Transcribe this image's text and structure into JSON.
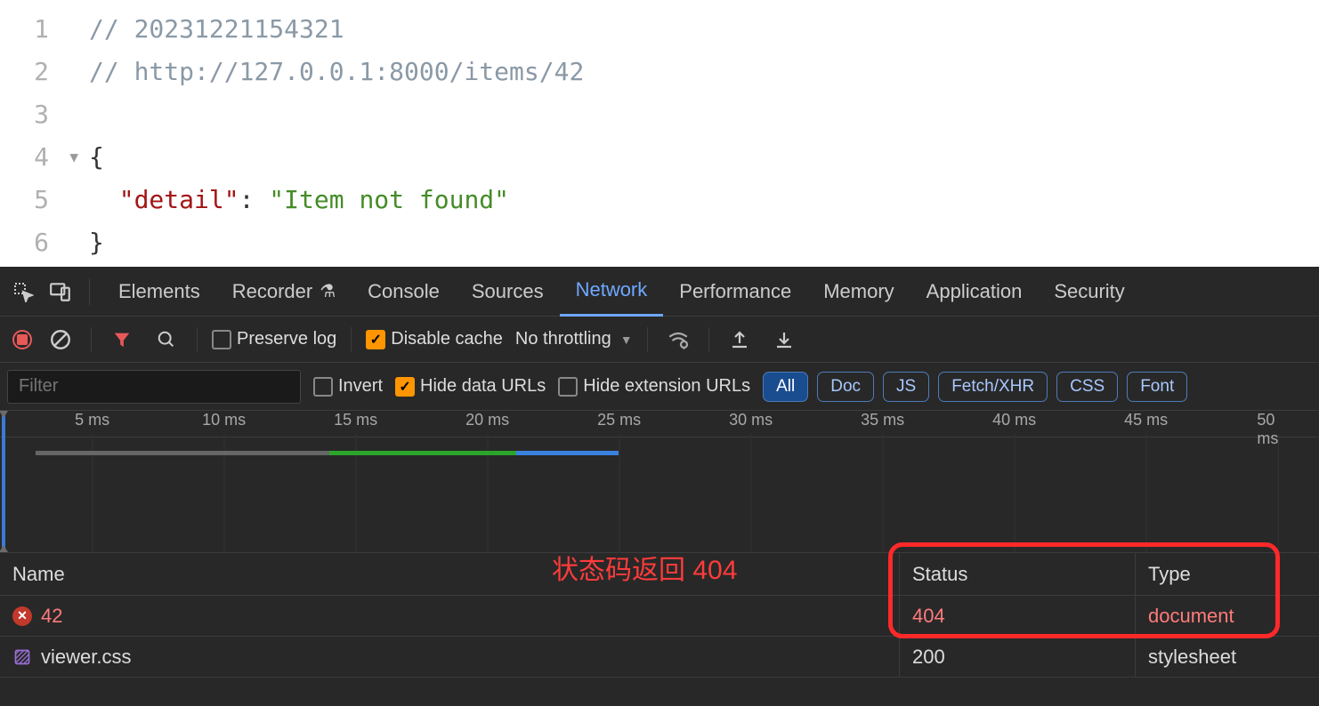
{
  "editor": {
    "lines": [
      {
        "num": "1",
        "type": "comment",
        "text": "// 20231221154321"
      },
      {
        "num": "2",
        "type": "comment",
        "text": "// http://127.0.0.1:8000/items/42"
      },
      {
        "num": "3",
        "type": "blank",
        "text": ""
      },
      {
        "num": "4",
        "type": "brace",
        "text": "{",
        "fold": "▼"
      },
      {
        "num": "5",
        "type": "kv",
        "key": "\"detail\"",
        "colon": ": ",
        "value": "\"Item not found\""
      },
      {
        "num": "6",
        "type": "brace",
        "text": "}"
      }
    ]
  },
  "devtools": {
    "tabs": [
      "Elements",
      "Recorder",
      "Console",
      "Sources",
      "Network",
      "Performance",
      "Memory",
      "Application",
      "Security"
    ],
    "active_tab": "Network",
    "toolbar": {
      "preserve_log": "Preserve log",
      "disable_cache": "Disable cache",
      "throttling": "No throttling"
    },
    "filter": {
      "placeholder": "Filter",
      "invert": "Invert",
      "hide_data": "Hide data URLs",
      "hide_ext": "Hide extension URLs",
      "chips": [
        "All",
        "Doc",
        "JS",
        "Fetch/XHR",
        "CSS",
        "Font"
      ],
      "active_chip": "All"
    },
    "timeline_ticks": [
      "5 ms",
      "10 ms",
      "15 ms",
      "20 ms",
      "25 ms",
      "30 ms",
      "35 ms",
      "40 ms",
      "45 ms",
      "50 ms"
    ],
    "table": {
      "headers": {
        "name": "Name",
        "status": "Status",
        "type": "Type"
      },
      "rows": [
        {
          "name": "42",
          "status": "404",
          "type": "document",
          "error": true,
          "icon": "err"
        },
        {
          "name": "viewer.css",
          "status": "200",
          "type": "stylesheet",
          "error": false,
          "icon": "css"
        }
      ]
    }
  },
  "annotation": "状态码返回 404"
}
